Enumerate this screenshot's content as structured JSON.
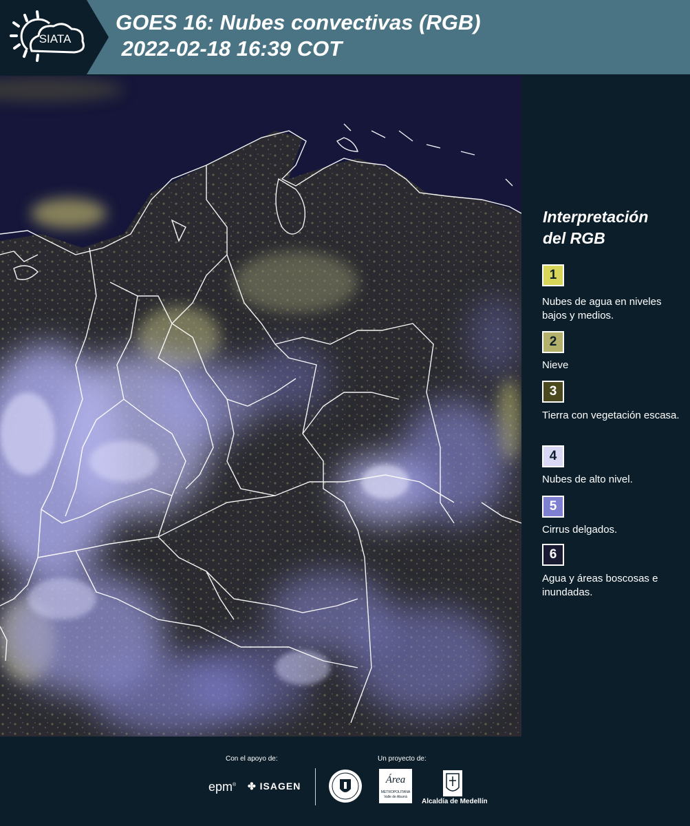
{
  "header": {
    "logo_text": "SIATA",
    "title": "GOES 16: Nubes convectivas (RGB)\n 2022-02-18 16:39 COT"
  },
  "legend": {
    "title_line1": "Interpretación",
    "title_line2": "del RGB",
    "items": [
      {
        "number": "1",
        "color": "#d8d65a",
        "text_color": "#0c1e2a",
        "label": "Nubes de agua en niveles bajos y medios."
      },
      {
        "number": "2",
        "color": "#b3b06b",
        "text_color": "#0c1e2a",
        "label": "Nieve"
      },
      {
        "number": "3",
        "color": "#4a4a1e",
        "text_color": "#ffffff",
        "label": "Tierra con vegetación escasa."
      },
      {
        "number": "4",
        "color": "#d9d9f6",
        "text_color": "#0c1e2a",
        "label": "Nubes de alto nivel."
      },
      {
        "number": "5",
        "color": "#7f7fd1",
        "text_color": "#ffffff",
        "label": "Cirrus delgados."
      },
      {
        "number": "6",
        "color": "#1b1a33",
        "text_color": "#ffffff",
        "label": "Agua y áreas boscosas e inundadas."
      }
    ]
  },
  "footer": {
    "support_caption": "Con el apoyo de:",
    "project_caption": "Un proyecto de:",
    "sponsor_epm": "epm",
    "sponsor_isagen": "ISAGEN",
    "partner_area_line1": "Área",
    "partner_area_line2": "METROPOLITANA",
    "partner_area_line3": "Valle de Aburrá",
    "partner_alcaldia": "Alcaldía de Medellín"
  },
  "colors": {
    "header_bg": "#4a7483",
    "panel_bg": "#0c1e2a",
    "cloud_high": "#c8c8f4",
    "cloud_low": "#c9c474",
    "ocean": "#15163a"
  }
}
